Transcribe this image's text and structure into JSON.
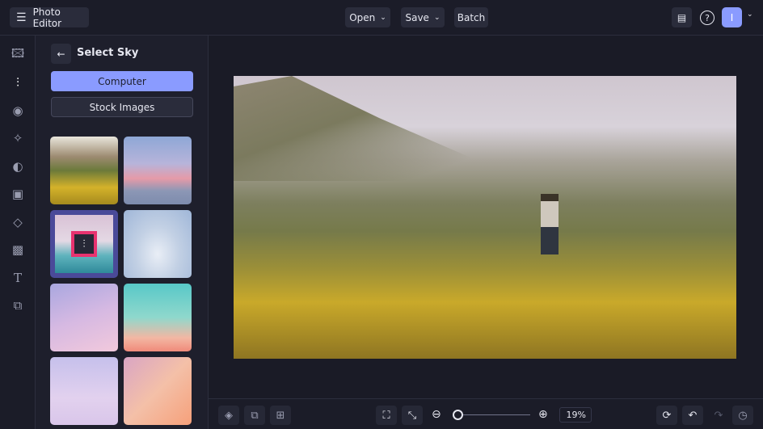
{
  "header": {
    "app_title": "Photo Editor",
    "open_label": "Open",
    "save_label": "Save",
    "batch_label": "Batch",
    "avatar_initial": "I"
  },
  "panel": {
    "title": "Select Sky",
    "computer_label": "Computer",
    "stock_label": "Stock Images"
  },
  "sidebar": {
    "items": [
      "image-icon",
      "adjust-icon",
      "eye-icon",
      "sparkles-icon",
      "palette-icon",
      "frame-icon",
      "shapes-icon",
      "texture-icon",
      "text-icon",
      "overlay-icon"
    ]
  },
  "bottom": {
    "zoom_value": "19%",
    "zoom_fraction": 0.02
  },
  "colors": {
    "accent": "#8a9bff",
    "selected": "#4a4a99",
    "highlight": "#e8326f"
  }
}
